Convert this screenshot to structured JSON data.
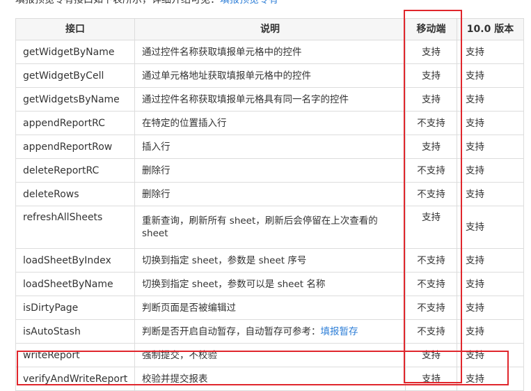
{
  "intro": {
    "text": "填报预览专有接口如下表所示，详细介绍可见：",
    "link": "填报预览专有"
  },
  "table": {
    "headers": [
      "接口",
      "说明",
      "移动端",
      "10.0 版本"
    ],
    "rows": [
      {
        "api": "getWidgetByName",
        "desc": "通过控件名称获取填报单元格中的控件",
        "mobile": "支持",
        "v10": "支持"
      },
      {
        "api": "getWidgetByCell",
        "desc": "通过单元格地址获取填报单元格中的控件",
        "mobile": "支持",
        "v10": "支持"
      },
      {
        "api": "getWidgetsByName",
        "desc": "通过控件名称获取填报单元格具有同一名字的控件",
        "mobile": "支持",
        "v10": "支持"
      },
      {
        "api": "appendReportRC",
        "desc": "在特定的位置插入行",
        "mobile": "不支持",
        "v10": "支持"
      },
      {
        "api": "appendReportRow",
        "desc": "插入行",
        "mobile": "支持",
        "v10": "支持"
      },
      {
        "api": "deleteReportRC",
        "desc": "删除行",
        "mobile": "不支持",
        "v10": "支持"
      },
      {
        "api": "deleteRows",
        "desc": "删除行",
        "mobile": "不支持",
        "v10": "支持"
      },
      {
        "api": "refreshAllSheets",
        "desc": "重新查询，刷新所有 sheet，刷新后会停留在上次查看的 sheet",
        "mobile": "支持",
        "v10": "支持"
      },
      {
        "api": "loadSheetByIndex",
        "desc": "切换到指定 sheet，参数是 sheet 序号",
        "mobile": "不支持",
        "v10": "支持"
      },
      {
        "api": "loadSheetByName",
        "desc": "切换到指定 sheet，参数可以是 sheet 名称",
        "mobile": "不支持",
        "v10": "支持"
      },
      {
        "api": "isDirtyPage",
        "desc": "判断页面是否被编辑过",
        "mobile": "不支持",
        "v10": "支持"
      },
      {
        "api": "isAutoStash",
        "desc": "判断是否开启自动暂存，自动暂存可参考：",
        "desc_link": "填报暂存",
        "mobile": "不支持",
        "v10": "支持"
      },
      {
        "api": "writeReport",
        "desc": "强制提交，不校验",
        "mobile": "支持",
        "v10": "支持"
      },
      {
        "api": "verifyAndWriteReport",
        "desc": "校验并提交报表",
        "mobile": "支持",
        "v10": "支持"
      }
    ]
  },
  "colors": {
    "highlight": "#e0262c",
    "link": "#2f7fd7"
  }
}
